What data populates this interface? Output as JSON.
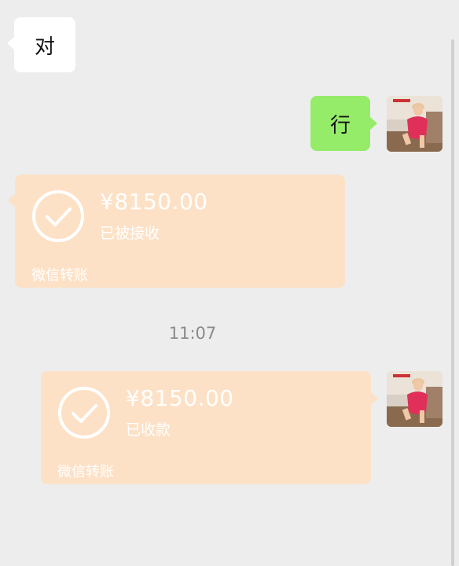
{
  "messages": {
    "incoming_text": "对",
    "outgoing_text": "行"
  },
  "transfer_received": {
    "amount": "¥8150.00",
    "status": "已被接收",
    "caption": "微信转账"
  },
  "timestamp": "11:07",
  "transfer_sent": {
    "amount": "¥8150.00",
    "status": "已收款",
    "caption": "微信转账"
  },
  "colors": {
    "background": "#ededed",
    "outgoing_bubble": "#95ec69",
    "incoming_bubble": "#ffffff",
    "transfer_card": "#fde1c6"
  },
  "icons": {
    "transfer_status": "check-circle-icon",
    "user_avatar": "avatar"
  }
}
